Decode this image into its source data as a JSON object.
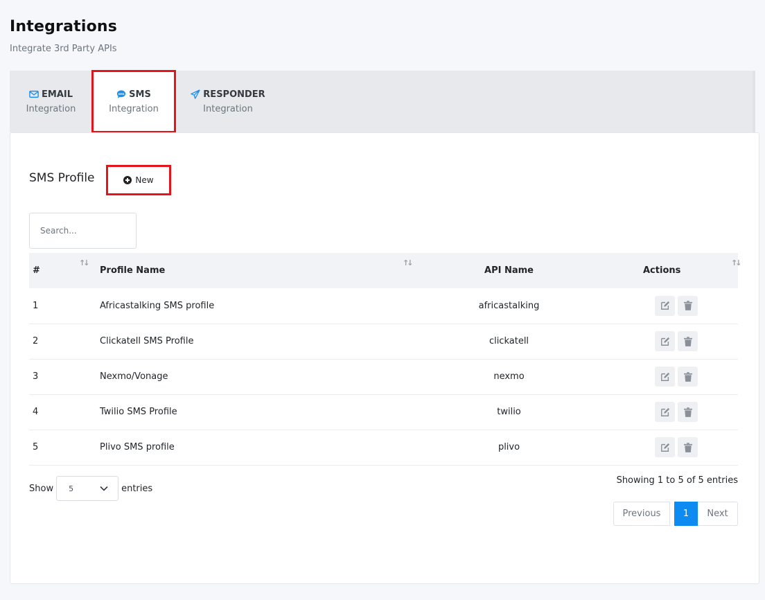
{
  "page": {
    "title": "Integrations",
    "subtitle": "Integrate 3rd Party APIs"
  },
  "tabs": [
    {
      "label": "EMAIL",
      "sub": "Integration",
      "icon": "envelope-icon",
      "active": false
    },
    {
      "label": "SMS",
      "sub": "Integration",
      "icon": "sms-bubble-icon",
      "active": true
    },
    {
      "label": "RESPONDER",
      "sub": "Integration",
      "icon": "paper-plane-icon",
      "active": false
    }
  ],
  "profile": {
    "title": "SMS Profile",
    "new_label": "New"
  },
  "search": {
    "placeholder": "Search..."
  },
  "table": {
    "headers": [
      "#",
      "Profile Name",
      "API Name",
      "Actions"
    ],
    "rows": [
      {
        "num": "1",
        "name": "Africastalking SMS profile",
        "api": "africastalking"
      },
      {
        "num": "2",
        "name": "Clickatell SMS Profile",
        "api": "clickatell"
      },
      {
        "num": "3",
        "name": "Nexmo/Vonage",
        "api": "nexmo"
      },
      {
        "num": "4",
        "name": "Twilio SMS Profile",
        "api": "twilio"
      },
      {
        "num": "5",
        "name": "Plivo SMS profile",
        "api": "plivo"
      }
    ]
  },
  "footer": {
    "show_label": "Show",
    "entries_value": "5",
    "entries_label": "entries",
    "info": "Showing 1 to 5 of 5 entries",
    "prev": "Previous",
    "page": "1",
    "next": "Next"
  },
  "colors": {
    "accent": "#0d8bf0",
    "highlight": "#e3151a"
  }
}
